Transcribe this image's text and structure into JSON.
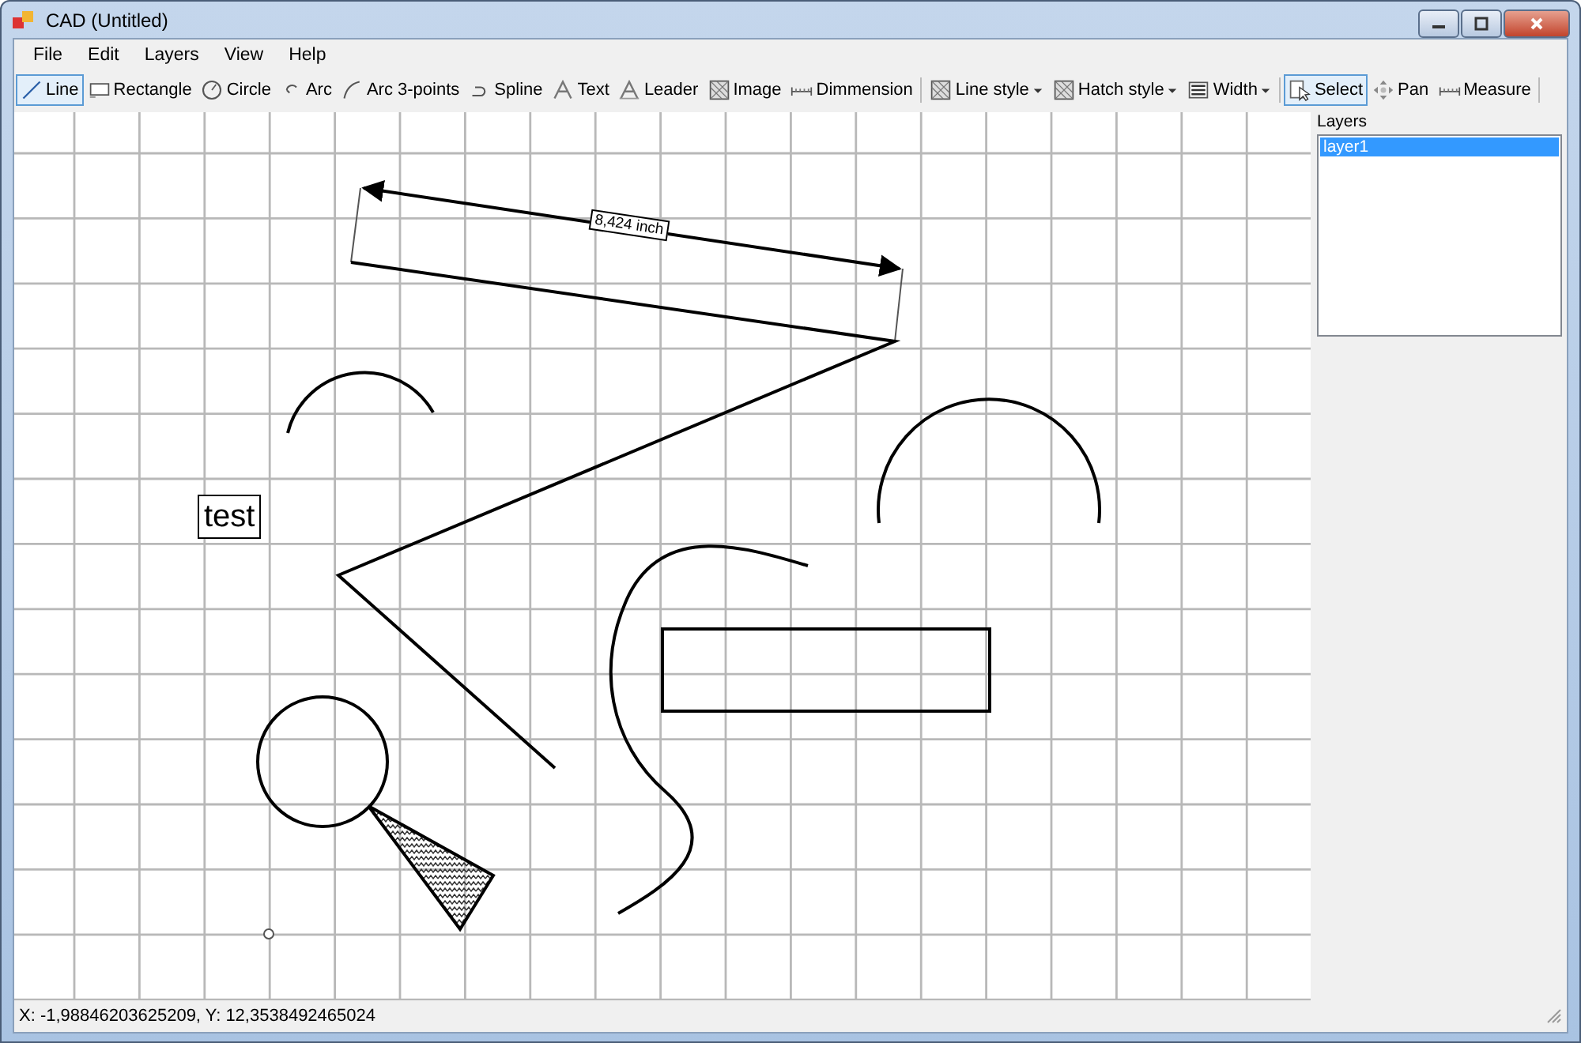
{
  "window": {
    "title": "CAD (Untitled)"
  },
  "menu": [
    "File",
    "Edit",
    "Layers",
    "View",
    "Help"
  ],
  "toolbar": {
    "groups": [
      [
        {
          "kind": "line",
          "label": "Line",
          "selected": true
        },
        {
          "kind": "rect",
          "label": "Rectangle",
          "selected": false
        },
        {
          "kind": "circle",
          "label": "Circle",
          "selected": false
        },
        {
          "kind": "arc",
          "label": "Arc",
          "selected": false
        },
        {
          "kind": "arc3",
          "label": "Arc 3-points",
          "selected": false
        },
        {
          "kind": "spline",
          "label": "Spline",
          "selected": false
        },
        {
          "kind": "text",
          "label": "Text",
          "selected": false
        },
        {
          "kind": "leader",
          "label": "Leader",
          "selected": false
        },
        {
          "kind": "image",
          "label": "Image",
          "selected": false
        },
        {
          "kind": "dimension",
          "label": "Dimmension",
          "selected": false
        }
      ],
      [
        {
          "kind": "hatch",
          "label": "Line style",
          "dropdown": true
        },
        {
          "kind": "hatch",
          "label": "Hatch style",
          "dropdown": true
        },
        {
          "kind": "width",
          "label": "Width",
          "dropdown": true
        }
      ],
      [
        {
          "kind": "select",
          "label": "Select",
          "selected": true
        },
        {
          "kind": "pan",
          "label": "Pan",
          "selected": false
        },
        {
          "kind": "dimension",
          "label": "Measure",
          "selected": false
        }
      ]
    ]
  },
  "canvas": {
    "dimension_label": "8,424 inch",
    "text_entity": "test"
  },
  "layers_panel": {
    "title": "Layers",
    "layers": [
      {
        "name": "layer1",
        "selected": true
      }
    ]
  },
  "status_bar": "X: -1,98846203625209, Y: 12,3538492465024"
}
